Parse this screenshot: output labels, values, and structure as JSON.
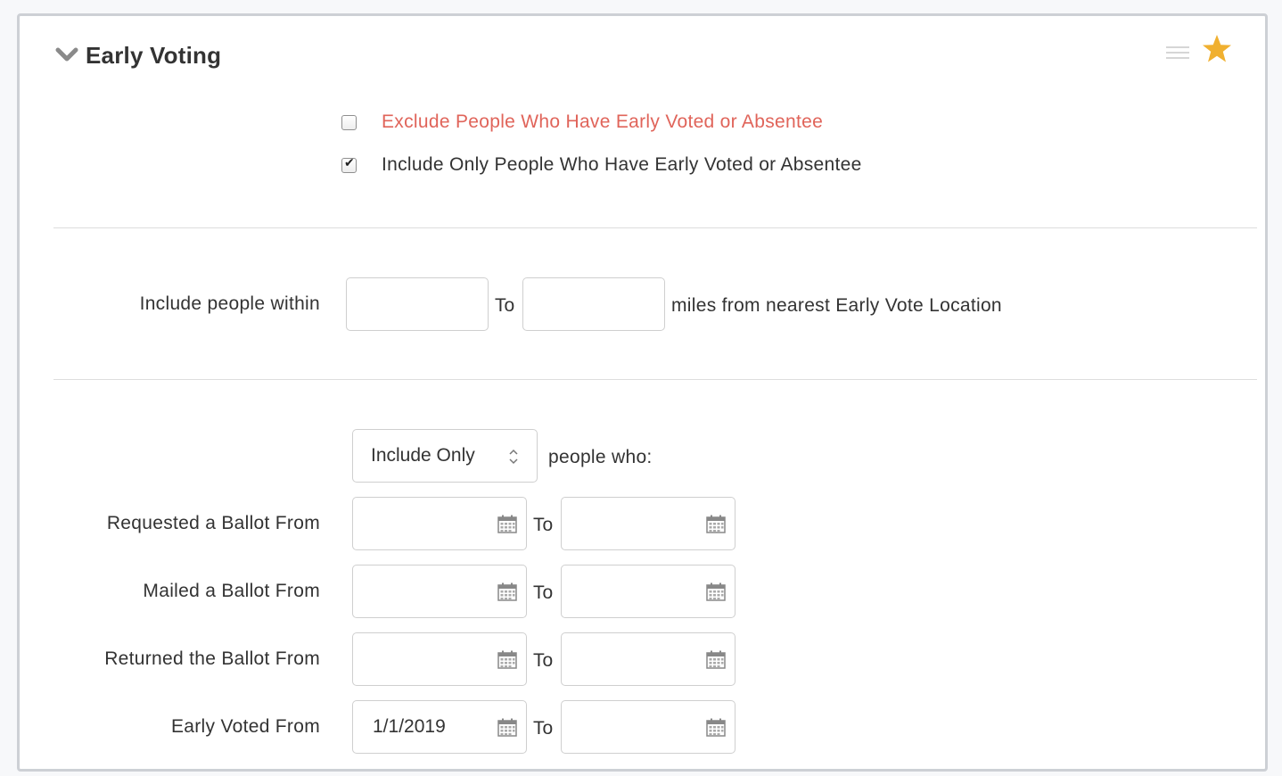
{
  "section": {
    "title": "Early Voting",
    "accent_color": "#f0b030",
    "warning_color": "#e0645a"
  },
  "early_vote_options": {
    "exclude": {
      "label": "Exclude People Who Have Early Voted or Absentee",
      "checked": false
    },
    "include_only": {
      "label": "Include Only People Who Have Early Voted or Absentee",
      "checked": true
    }
  },
  "distance": {
    "label": "Include people within",
    "from_value": "",
    "to_label": "To",
    "to_value": "",
    "suffix": "miles from nearest Early Vote Location"
  },
  "filter_mode": {
    "selected": "Include Only",
    "suffix": "people who:"
  },
  "date_ranges": [
    {
      "label": "Requested a Ballot From",
      "from": "",
      "to_label": "To",
      "to": ""
    },
    {
      "label": "Mailed a Ballot From",
      "from": "",
      "to_label": "To",
      "to": ""
    },
    {
      "label": "Returned the Ballot From",
      "from": "",
      "to_label": "To",
      "to": ""
    },
    {
      "label": "Early Voted From",
      "from": "1/1/2019",
      "to_label": "To",
      "to": ""
    }
  ]
}
